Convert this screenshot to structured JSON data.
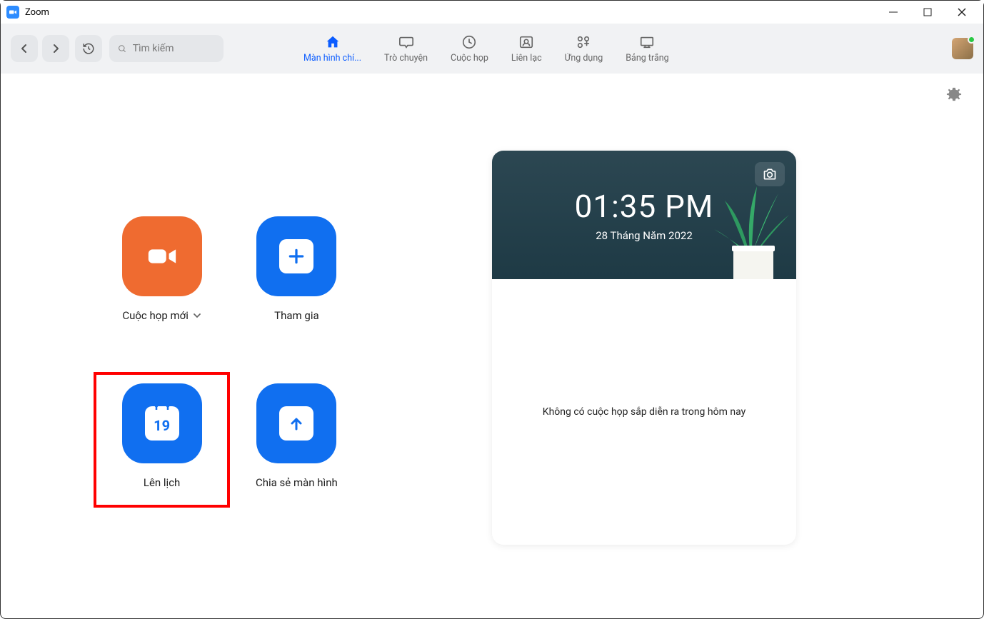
{
  "titlebar": {
    "app_name": "Zoom"
  },
  "toolbar": {
    "search_placeholder": "Tìm kiếm"
  },
  "tabs": {
    "home": "Màn hình chí...",
    "chat": "Trò chuyện",
    "meetings": "Cuộc họp",
    "contacts": "Liên lạc",
    "apps": "Ứng dụng",
    "whiteboard": "Bảng trắng"
  },
  "actions": {
    "new_meeting": "Cuộc họp mới",
    "join": "Tham gia",
    "schedule": "Lên lịch",
    "schedule_day": "19",
    "share_screen": "Chia sẻ màn hình"
  },
  "calendar": {
    "time": "01:35 PM",
    "date": "28 Tháng Năm 2022",
    "empty_message": "Không có cuộc họp sắp diễn ra trong hôm nay"
  }
}
